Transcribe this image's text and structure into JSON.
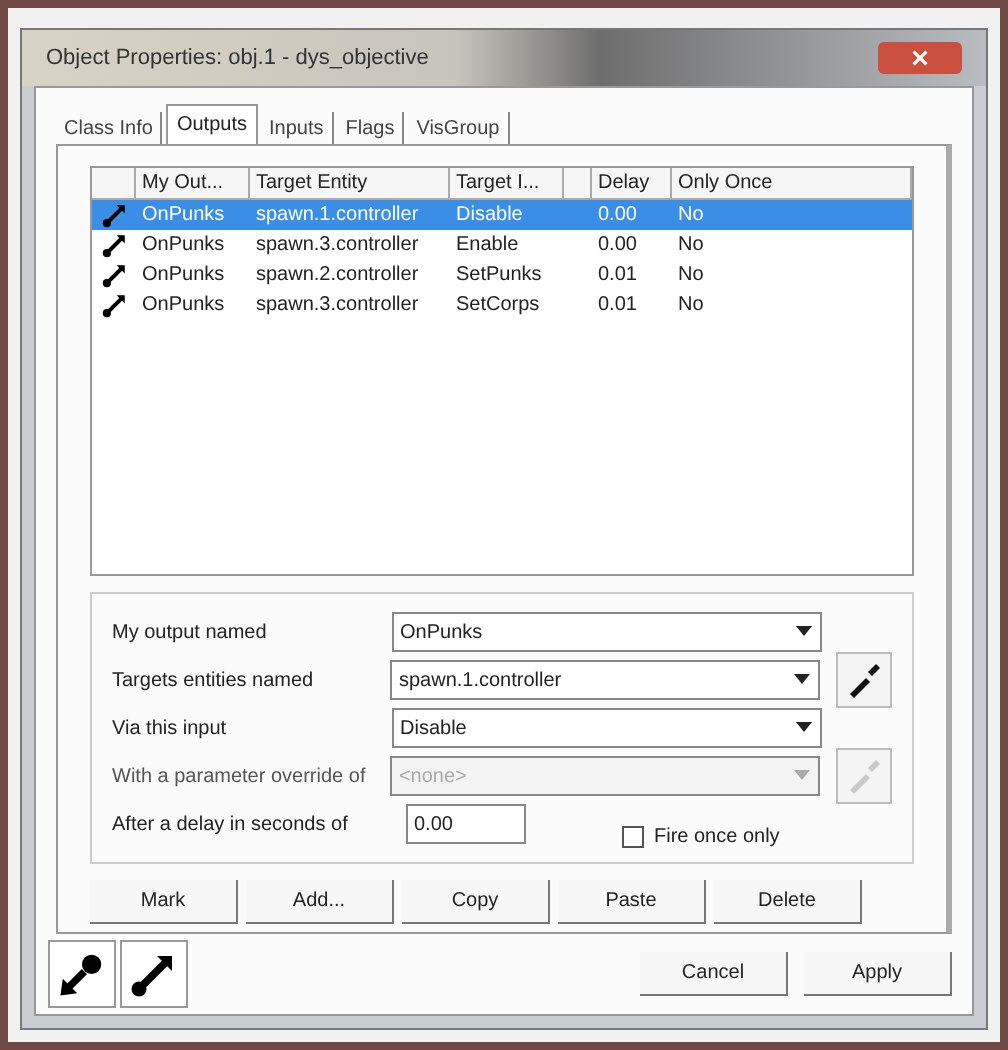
{
  "window": {
    "title": "Object Properties: obj.1 - dys_objective"
  },
  "tabs": [
    {
      "label": "Class Info",
      "selected": false
    },
    {
      "label": "Outputs",
      "selected": true
    },
    {
      "label": "Inputs",
      "selected": false
    },
    {
      "label": "Flags",
      "selected": false
    },
    {
      "label": "VisGroup",
      "selected": false
    }
  ],
  "table": {
    "columns": [
      "My Out...",
      "Target Entity",
      "Target I...",
      "",
      "Delay",
      "Only Once"
    ],
    "rows": [
      {
        "selected": true,
        "cells": [
          "OnPunks",
          "spawn.1.controller",
          "Disable",
          "",
          "0.00",
          "No"
        ]
      },
      {
        "selected": false,
        "cells": [
          "OnPunks",
          "spawn.3.controller",
          "Enable",
          "",
          "0.00",
          "No"
        ]
      },
      {
        "selected": false,
        "cells": [
          "OnPunks",
          "spawn.2.controller",
          "SetPunks",
          "",
          "0.01",
          "No"
        ]
      },
      {
        "selected": false,
        "cells": [
          "OnPunks",
          "spawn.3.controller",
          "SetCorps",
          "",
          "0.01",
          "No"
        ]
      }
    ]
  },
  "form": {
    "fields": [
      {
        "label": "My output named",
        "value": "OnPunks",
        "kind": "combo",
        "disabled": false,
        "picker": false
      },
      {
        "label": "Targets entities named",
        "value": "spawn.1.controller",
        "kind": "combo",
        "disabled": false,
        "picker": true
      },
      {
        "label": "Via this input",
        "value": "Disable",
        "kind": "combo",
        "disabled": false,
        "picker": false
      },
      {
        "label": "With a parameter override of",
        "value": "<none>",
        "kind": "combo",
        "disabled": true,
        "picker": true
      },
      {
        "label": "After a delay in seconds of",
        "value": "0.00",
        "kind": "text",
        "disabled": false,
        "picker": false
      }
    ],
    "fire_once": {
      "label": "Fire once only",
      "checked": false
    }
  },
  "actions": [
    "Mark",
    "Add...",
    "Copy",
    "Paste",
    "Delete"
  ],
  "footer": {
    "buttons": [
      "Cancel",
      "Apply"
    ]
  }
}
